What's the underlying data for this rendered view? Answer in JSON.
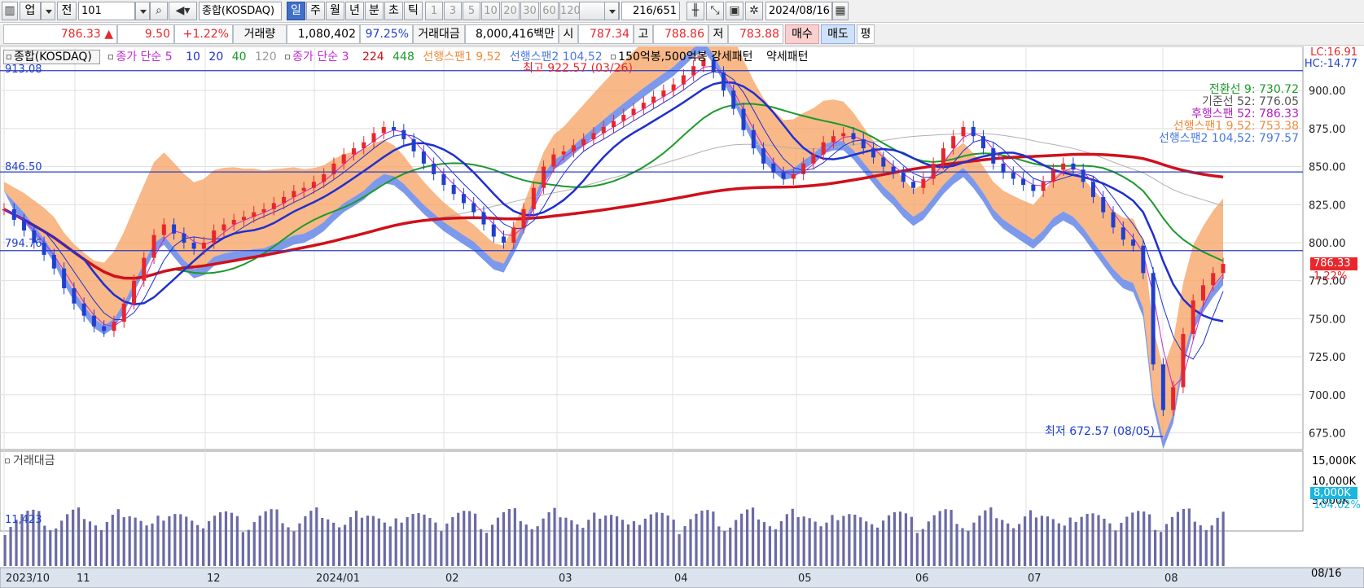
{
  "toolbar": {
    "type_label": "업",
    "prev_label": "전",
    "code_value": "101",
    "market_name": "종합(KOSDAQ)",
    "period_tabs": [
      {
        "label": "일",
        "selected": true
      },
      {
        "label": "주",
        "selected": false
      },
      {
        "label": "월",
        "selected": false
      },
      {
        "label": "년",
        "selected": false
      },
      {
        "label": "분",
        "selected": false
      },
      {
        "label": "초",
        "selected": false
      },
      {
        "label": "틱",
        "selected": false
      }
    ],
    "interval_buttons": [
      "1",
      "3",
      "5",
      "10",
      "20",
      "30",
      "60",
      "120"
    ],
    "count_value": "216",
    "count_total": "/651",
    "date_value": "2024/08/16",
    "icons": [
      "layout-icon",
      "speaker-icon",
      "search-icon",
      "candle-icon",
      "trend-icon",
      "save-icon",
      "gear-icon",
      "calendar-icon"
    ]
  },
  "quote": {
    "price": "786.33",
    "change_arrow": "▲",
    "change": "9.50",
    "change_pct": "+1.22%",
    "volume_label": "거래량",
    "volume": "1,080,402",
    "volume_ratio": "97.25%",
    "amount_label": "거래대금",
    "amount": "8,000,416백만",
    "open_label": "시",
    "open": "787.34",
    "high_label": "고",
    "high": "788.86",
    "low_label": "저",
    "low": "783.88",
    "buy_label": "매수",
    "sell_label": "매도",
    "eval_label": "평"
  },
  "legend": {
    "market": "종합(KOSDAQ)",
    "ma5_label": "종가 단순 5",
    "ma_periods": [
      "10",
      "20",
      "40",
      "120"
    ],
    "ma3_label": "종가 단순 3",
    "ma3_periods": [
      "224",
      "448"
    ],
    "span1_label": "선행스팬1 9,52",
    "span2_label": "선행스팬2 104,52",
    "pattern_label": "150억봉,500억봉 강세패턴",
    "weak_label": "약세패턴"
  },
  "ichimoku": {
    "conversion": "전환선 9: 730.72",
    "base": "기준선 52: 776.05",
    "lagging": "후행스팬 52: 786.33",
    "span1": "선행스팬1 9,52: 753.38",
    "span2": "선행스팬2 104,52: 797.57"
  },
  "annotations": {
    "hline_top": "913.08",
    "hline_mid": "846.50",
    "hline_low": "794.76",
    "high_note": "최고 922.57 (03/26)",
    "low_note": "최저 672.57 (08/05)",
    "lc": "LC:16.91",
    "hc": "HC:-14.77",
    "price_tag": "786.33",
    "pct_tag": "1.22%",
    "vol_tag": "8,000K",
    "vol_pct_tag": "104.02%",
    "vol_min": "11,423",
    "date_end": "08/16"
  },
  "volume_panel": {
    "label": "거래대금",
    "ticks": [
      "15,000K",
      "10,000K",
      "5,000K"
    ]
  },
  "chart_data": {
    "type": "line",
    "price_axis": {
      "ticks": [
        "900.00",
        "875.00",
        "850.00",
        "825.00",
        "800.00",
        "775.00",
        "750.00",
        "725.00",
        "700.00",
        "675.00"
      ],
      "ylim": [
        664,
        929
      ]
    },
    "x_ticks": [
      "2023/10",
      "11",
      "12",
      "2024/01",
      "02",
      "03",
      "04",
      "05",
      "06",
      "07",
      "08"
    ],
    "last_close": 786.33,
    "high": 922.57,
    "low": 672.57,
    "series": [
      {
        "name": "종합(KOSDAQ)",
        "values": [
          822,
          815,
          808,
          800,
          792,
          783,
          770,
          760,
          752,
          745,
          742,
          748,
          760,
          775,
          790,
          805,
          812,
          806,
          800,
          796,
          800,
          808,
          812,
          815,
          817,
          820,
          822,
          826,
          830,
          834,
          836,
          840,
          845,
          852,
          858,
          862,
          866,
          872,
          876,
          874,
          868,
          860,
          852,
          845,
          838,
          832,
          826,
          820,
          812,
          804,
          800,
          810,
          822,
          836,
          850,
          858,
          860,
          864,
          868,
          872,
          876,
          880,
          884,
          888,
          892,
          896,
          900,
          904,
          910,
          916,
          920,
          912,
          900,
          888,
          874,
          862,
          852,
          846,
          842,
          845,
          852,
          858,
          866,
          870,
          872,
          868,
          862,
          856,
          850,
          846,
          840,
          836,
          842,
          852,
          862,
          870,
          876,
          870,
          862,
          852,
          846,
          842,
          838,
          834,
          840,
          848,
          852,
          848,
          840,
          830,
          820,
          810,
          802,
          798,
          780,
          720,
          690,
          705,
          740,
          762,
          772,
          780,
          786
        ]
      }
    ]
  }
}
